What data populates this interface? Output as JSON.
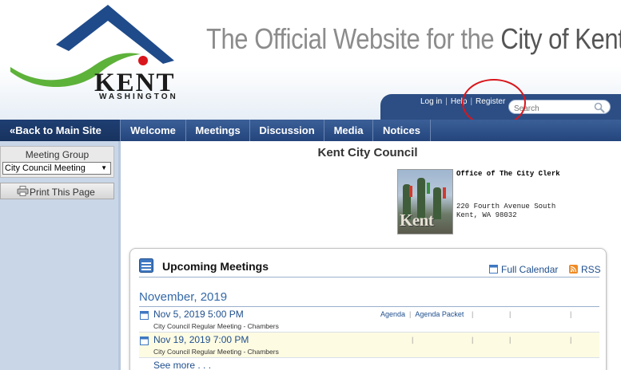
{
  "header": {
    "logo": {
      "word": "KENT",
      "sub": "WASHINGTON"
    },
    "title_prefix": "The Official Website for the ",
    "title_city": "City of Kent",
    "account": {
      "login": "Log in",
      "help": "Help",
      "register": "Register",
      "sep": "|"
    },
    "search": {
      "placeholder": "Search"
    },
    "colors": {
      "brand_blue": "#2c4e84",
      "logo_green": "#5db23a",
      "logo_navy": "#1f4b8a",
      "logo_red": "#d9161c",
      "annotation_red": "#d9161c"
    }
  },
  "nav": {
    "back": "«Back to Main Site",
    "items": [
      "Welcome",
      "Meetings",
      "Discussion",
      "Media",
      "Notices"
    ]
  },
  "sidebar": {
    "meeting_group_label": "Meeting Group",
    "meeting_group_value": "City Council Meeting",
    "caret": "▼",
    "print_label": "Print This Page"
  },
  "main": {
    "council_title": "Kent City Council",
    "photo_text": "Kent",
    "office": {
      "name": "Office of The City Clerk",
      "address1": "220 Fourth Avenue South",
      "address2": "Kent, WA 98032"
    }
  },
  "upcoming": {
    "title": "Upcoming Meetings",
    "full_calendar": "Full Calendar",
    "rss": "RSS",
    "month": "November, 2019",
    "meetings": [
      {
        "date": "Nov 5, 2019 5:00 PM",
        "desc": "City Council Regular Meeting - Chambers",
        "agenda": "Agenda",
        "packet": "Agenda Packet"
      },
      {
        "date": "Nov 19, 2019 7:00 PM",
        "desc": "City Council Regular Meeting - Chambers",
        "agenda": "",
        "packet": ""
      }
    ],
    "see_more": "See more . . ."
  }
}
